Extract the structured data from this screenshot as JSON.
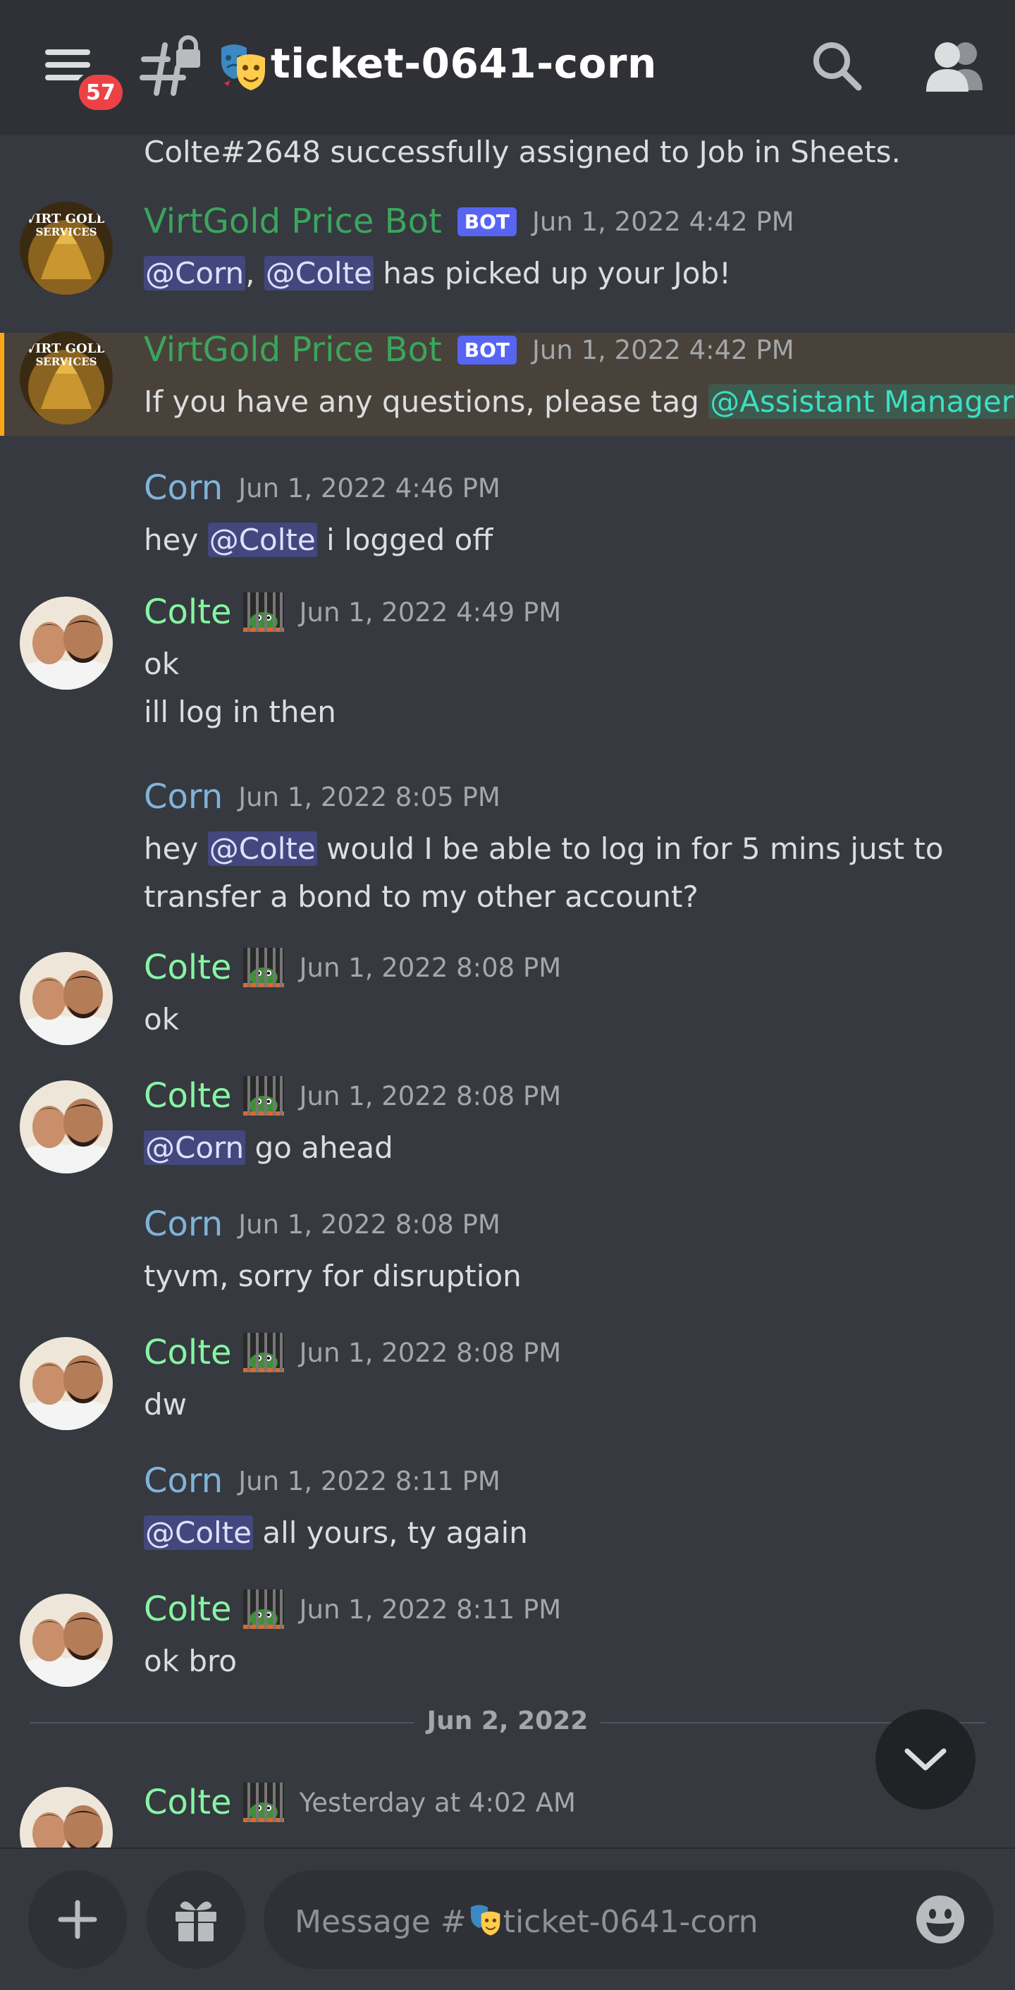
{
  "header": {
    "badge_count": "57",
    "channel_name": "ticket-0641-corn",
    "channel_emoji": "performing-arts"
  },
  "messages": {
    "m0": {
      "text": "Colte#2648 successfully assigned to Job in Sheets."
    },
    "m1": {
      "author": "VirtGold Price Bot",
      "bot_tag": "BOT",
      "timestamp": "Jun 1, 2022 4:42 PM",
      "mention1": "@Corn",
      "sep": ",",
      "mention2": "@Colte",
      "text": "has picked up your Job!",
      "avatar_text": "VIRT GOLD SERVICES"
    },
    "m2": {
      "author": "VirtGold Price Bot",
      "bot_tag": "BOT",
      "timestamp": "Jun 1, 2022 4:42 PM",
      "text": "If you have any questions, please tag",
      "mention": "@Assistant Manager"
    },
    "m3": {
      "author": "Corn",
      "timestamp": "Jun 1, 2022 4:46 PM",
      "pre": "hey",
      "mention": "@Colte",
      "post": "i logged off"
    },
    "m4": {
      "author": "Colte",
      "timestamp": "Jun 1, 2022 4:49 PM",
      "line1": "ok",
      "line2": "ill log in then"
    },
    "m5": {
      "author": "Corn",
      "timestamp": "Jun 1, 2022 8:05 PM",
      "pre": "hey",
      "mention": "@Colte",
      "post": "would I be able to log in for 5 mins just to",
      "line2": "transfer a bond to my other account?"
    },
    "m6": {
      "author": "Colte",
      "timestamp": "Jun 1, 2022 8:08 PM",
      "text": "ok"
    },
    "m7": {
      "author": "Colte",
      "timestamp": "Jun 1, 2022 8:08 PM",
      "mention": "@Corn",
      "post": "go ahead"
    },
    "m8": {
      "author": "Corn",
      "timestamp": "Jun 1, 2022 8:08 PM",
      "text": "tyvm, sorry for disruption"
    },
    "m9": {
      "author": "Colte",
      "timestamp": "Jun 1, 2022 8:08 PM",
      "text": "dw"
    },
    "m10": {
      "author": "Corn",
      "timestamp": "Jun 1, 2022 8:11 PM",
      "mention": "@Colte",
      "post": "all yours, ty again"
    },
    "m11": {
      "author": "Colte",
      "timestamp": "Jun 1, 2022 8:11 PM",
      "text": "ok bro"
    },
    "m12": {
      "author": "Colte",
      "timestamp": "Yesterday at 4:02 AM"
    }
  },
  "date_separator": "Jun 2, 2022",
  "composer": {
    "placeholder_prefix": "Message #",
    "placeholder_channel": "ticket-0641-corn"
  },
  "colors": {
    "background": "#36393f",
    "header": "#2f3136",
    "bot_name": "#3ba55d",
    "corn_name": "#7fb4d9",
    "colte_name": "#86f5a3",
    "mention_bg": "#5865f2",
    "badge": "#ed4245",
    "highlight_bar": "#faa81a"
  },
  "icons": [
    "hamburger-menu-icon",
    "text-channel-locked-icon",
    "search-icon",
    "members-icon",
    "chevron-down-icon",
    "plus-icon",
    "gift-icon",
    "emoji-icon",
    "jail-cell-emoji"
  ]
}
